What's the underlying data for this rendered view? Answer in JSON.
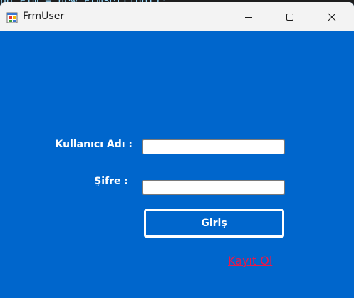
{
  "background_code": "nd Fim = new FrmSetting();",
  "window": {
    "title": "FrmUser",
    "app_icon": "winforms-app-icon",
    "controls": {
      "minimize_icon": "minimize-icon",
      "maximize_icon": "maximize-icon",
      "close_icon": "close-icon"
    }
  },
  "form": {
    "username_label": "Kullanıcı Adı :",
    "username_value": "",
    "password_label": "Şifre :",
    "password_value": "",
    "login_button": "Giriş",
    "register_link": "Kayıt Ol"
  },
  "colors": {
    "form_background": "#0066cc",
    "titlebar_background": "#f3f3f3",
    "link": "#e8194a",
    "text": "#ffffff"
  }
}
